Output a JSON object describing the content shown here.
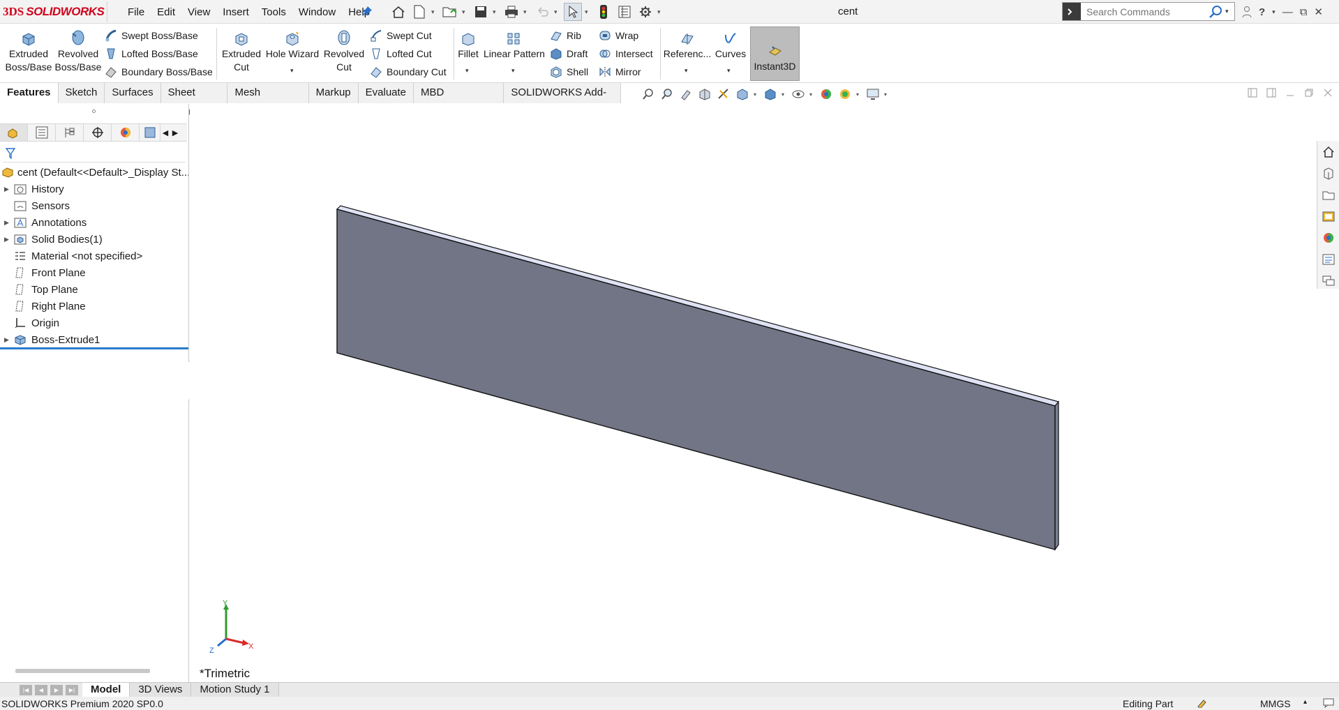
{
  "app": {
    "brand": "SOLIDWORKS",
    "brand_prefix": "3DS"
  },
  "menu": [
    "File",
    "Edit",
    "View",
    "Insert",
    "Tools",
    "Window",
    "Help"
  ],
  "document_title": "cent",
  "search": {
    "placeholder": "Search Commands"
  },
  "ribbon": {
    "extruded_boss": "Extruded\nBoss/Base",
    "revolved_boss": "Revolved\nBoss/Base",
    "swept_boss": "Swept Boss/Base",
    "lofted_boss": "Lofted Boss/Base",
    "boundary_boss": "Boundary Boss/Base",
    "extruded_cut": "Extruded\nCut",
    "hole_wizard": "Hole Wizard",
    "revolved_cut": "Revolved\nCut",
    "swept_cut": "Swept Cut",
    "lofted_cut": "Lofted Cut",
    "boundary_cut": "Boundary Cut",
    "fillet": "Fillet",
    "linear_pattern": "Linear Pattern",
    "rib": "Rib",
    "draft": "Draft",
    "shell": "Shell",
    "wrap": "Wrap",
    "intersect": "Intersect",
    "mirror": "Mirror",
    "reference": "Referenc...",
    "curves": "Curves",
    "instant3d": "Instant3D"
  },
  "command_tabs": [
    "Features",
    "Sketch",
    "Surfaces",
    "Sheet Metal",
    "Mesh Modeling",
    "Markup",
    "Evaluate",
    "MBD Dimensions",
    "SOLIDWORKS Add-Ins"
  ],
  "tree": {
    "root": "cent  (Default<<Default>_Display St...",
    "items": [
      {
        "label": "History",
        "expandable": true
      },
      {
        "label": "Sensors",
        "expandable": false
      },
      {
        "label": "Annotations",
        "expandable": true
      },
      {
        "label": "Solid Bodies(1)",
        "expandable": true
      },
      {
        "label": "Material <not specified>",
        "expandable": false
      },
      {
        "label": "Front Plane",
        "expandable": false
      },
      {
        "label": "Top Plane",
        "expandable": false
      },
      {
        "label": "Right Plane",
        "expandable": false
      },
      {
        "label": "Origin",
        "expandable": false
      },
      {
        "label": "Boss-Extrude1",
        "expandable": true
      }
    ]
  },
  "viewport": {
    "view_name": "*Trimetric",
    "triad": {
      "x": "X",
      "y": "Y",
      "z": "Z"
    }
  },
  "bottom_tabs": [
    "Model",
    "3D Views",
    "Motion Study 1"
  ],
  "status": {
    "version": "SOLIDWORKS Premium 2020 SP0.0",
    "mode": "Editing Part",
    "units": "MMGS"
  },
  "colors": {
    "brand_red": "#d0021b",
    "part_face": "#717586",
    "part_top": "#dfe2f4",
    "rollback_bar": "#2b7bd0"
  }
}
